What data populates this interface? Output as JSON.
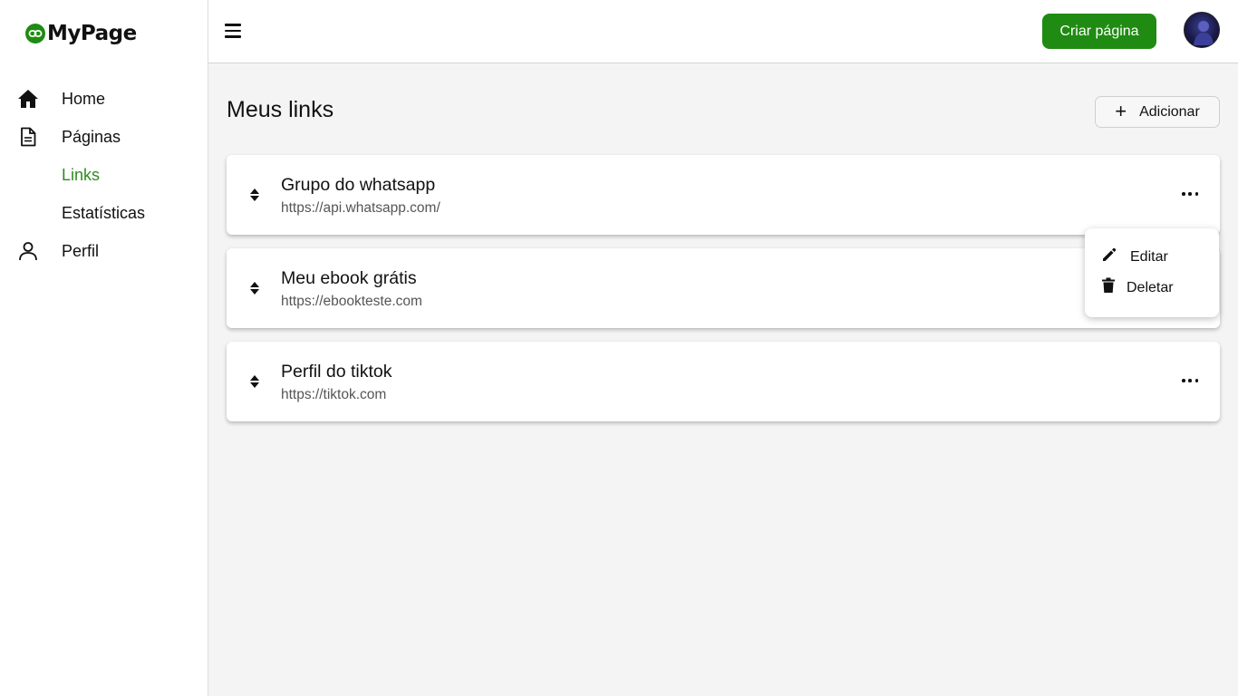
{
  "app": {
    "logo_text": "MyPage",
    "brand_color": "#1f8b12",
    "active_color": "#2e8b1f"
  },
  "sidebar": {
    "items": [
      {
        "label": "Home",
        "icon": "home-icon"
      },
      {
        "label": "Páginas",
        "icon": "document-icon"
      },
      {
        "label": "Links",
        "icon": "",
        "active": true
      },
      {
        "label": "Estatísticas",
        "icon": ""
      },
      {
        "label": "Perfil",
        "icon": "user-icon"
      }
    ]
  },
  "header": {
    "menu_icon": "hamburger-icon",
    "create_label": "Criar página",
    "avatar_icon": "avatar"
  },
  "main": {
    "title": "Meus links",
    "add_label": "Adicionar",
    "links": [
      {
        "title": "Grupo do whatsapp",
        "url": "https://api.whatsapp.com/"
      },
      {
        "title": "Meu ebook grátis",
        "url": "https://ebookteste.com"
      },
      {
        "title": "Perfil do tiktok",
        "url": "https://tiktok.com"
      }
    ]
  },
  "dropdown": {
    "edit_label": "Editar",
    "delete_label": "Deletar"
  }
}
